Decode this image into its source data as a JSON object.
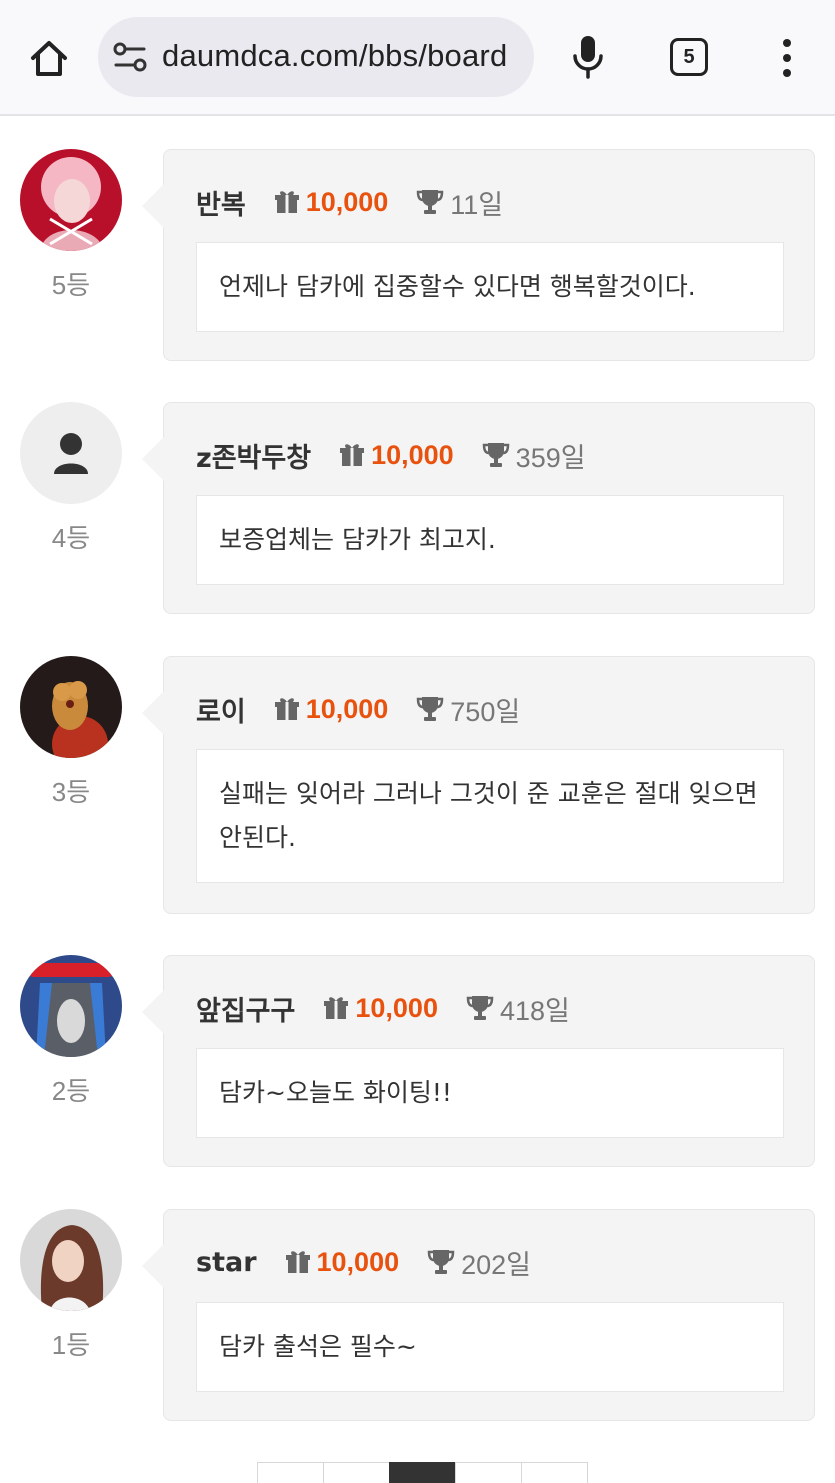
{
  "browser": {
    "url": "daumdca.com/bbs/board",
    "tab_count": "5",
    "icons": [
      "home-icon",
      "site-settings-icon",
      "mic-icon",
      "tabs-icon",
      "more-vert-icon"
    ]
  },
  "comments": [
    {
      "rank": "5등",
      "nickname": "반복",
      "points": "10,000",
      "days": "11일",
      "message": "언제나 담카에 집중할수 있다면 행복할것이다.",
      "avatar": "photo"
    },
    {
      "rank": "4등",
      "nickname": "z존박두창",
      "points": "10,000",
      "days": "359일",
      "message": "보증업체는 담카가 최고지.",
      "avatar": "default-user"
    },
    {
      "rank": "3등",
      "nickname": "로이",
      "points": "10,000",
      "days": "750일",
      "message": "실패는 잊어라 그러나 그것이 준 교훈은 절대 잊으면 안된다.",
      "avatar": "cartoon"
    },
    {
      "rank": "2등",
      "nickname": "앞집구구",
      "points": "10,000",
      "days": "418일",
      "message": "담카~오늘도 화이팅!!",
      "avatar": "cartoon-bird"
    },
    {
      "rank": "1등",
      "nickname": "star",
      "points": "10,000",
      "days": "202일",
      "message": "담카 출석은 필수~",
      "avatar": "photo"
    }
  ],
  "colors": {
    "points": "#e8520e",
    "card_bg": "#f4f4f4",
    "pagination_active": "#333333"
  }
}
